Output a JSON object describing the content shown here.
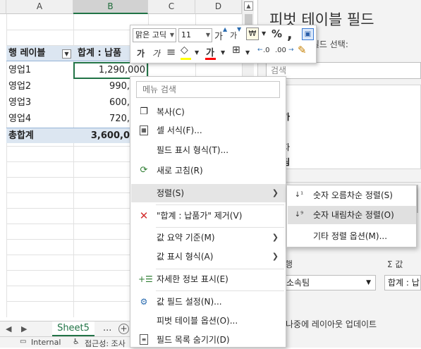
{
  "grid": {
    "columns": [
      "A",
      "B",
      "C",
      "D"
    ],
    "selected_column": "B",
    "pivot": {
      "row_label_header": "행 레이블",
      "value_header": "합계 : 납품",
      "rows": [
        {
          "label": "영업1",
          "value": "1,290,000"
        },
        {
          "label": "영업2",
          "value": "990,"
        },
        {
          "label": "영업3",
          "value": "600,"
        },
        {
          "label": "영업4",
          "value": "720,"
        }
      ],
      "total_label": "총합계",
      "total_value": "3,600,0"
    }
  },
  "sheet_tabs": {
    "active": "Sheet5",
    "more": "...",
    "add": "+"
  },
  "status_bar": {
    "sensitivity": "Internal",
    "accessibility": "접근성: 조사"
  },
  "mini_toolbar": {
    "font_name": "맑은 고딕",
    "font_size": "11",
    "grow_font": "가",
    "shrink_font": "가",
    "currency": "₩",
    "percent": "%",
    "comma": ",",
    "bold": "가",
    "italic": "가",
    "align": "≡",
    "font_color_glyph": "가",
    "font_color": "#ff0000",
    "fill_color": "#ffff00",
    "decrease_decimal": ".00",
    "increase_decimal": ".0"
  },
  "context_menu": {
    "search_placeholder": "메뉴 검색",
    "items": [
      {
        "label": "복사(C)",
        "icon": "copy-icon"
      },
      {
        "label": "셀 서식(F)...",
        "icon": "format-cells-icon"
      },
      {
        "label": "필드 표시 형식(T)...",
        "icon": ""
      },
      {
        "label": "새로 고침(R)",
        "icon": "refresh-icon"
      },
      {
        "label": "정렬(S)",
        "icon": "",
        "submenu": true
      },
      {
        "label": "\"합계 : 납품가\" 제거(V)",
        "icon": "remove-icon"
      },
      {
        "label": "값 요약 기준(M)",
        "icon": "",
        "submenu": true
      },
      {
        "label": "값 표시 형식(A)",
        "icon": "",
        "submenu": true
      },
      {
        "label": "자세한 정보 표시(E)",
        "icon": "show-detail-icon"
      },
      {
        "label": "값 필드 설정(N)...",
        "icon": "field-settings-icon"
      },
      {
        "label": "피벗 테이블 옵션(O)...",
        "icon": ""
      },
      {
        "label": "필드 목록 숨기기(D)",
        "icon": "field-list-icon"
      }
    ]
  },
  "sort_submenu": {
    "items": [
      {
        "label": "숫자 오름차순 정렬(S)",
        "icon": "sort-ascending-icon"
      },
      {
        "label": "숫자 내림차순 정렬(O)",
        "icon": "sort-descending-icon"
      },
      {
        "label": "기타 정렬 옵션(M)...",
        "icon": ""
      }
    ]
  },
  "pivot_pane": {
    "title": "피벗 테이블 필드",
    "subtitle": "할 필드 선택:",
    "search_placeholder": "검색",
    "fields": [
      {
        "label": "단가",
        "bold": false
      },
      {
        "label": "납품가",
        "bold": true
      },
      {
        "label": "지역",
        "bold": false
      },
      {
        "label": "담당자",
        "bold": false
      },
      {
        "label": "소속팀",
        "bold": true
      }
    ],
    "rows_area_label": "행",
    "values_area_label": "Σ 값",
    "rows_area_value": "소속팀",
    "values_area_value": "합계 : 납",
    "defer_update": "나중에 레이아웃 업데이트"
  }
}
